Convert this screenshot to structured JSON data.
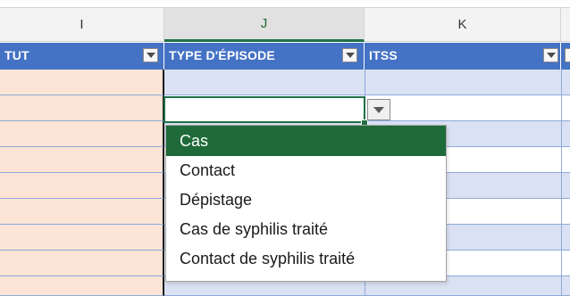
{
  "columns": [
    {
      "letter": "I",
      "selected": false
    },
    {
      "letter": "J",
      "selected": true
    },
    {
      "letter": "K",
      "selected": false
    }
  ],
  "headers": {
    "col_i": "TUT",
    "col_j": "TYPE D'ÉPISODE",
    "col_k": "ITSS"
  },
  "dropdown": {
    "selected_index": 0,
    "options": [
      "Cas",
      "Contact",
      "Dépistage",
      "Cas de syphilis traité",
      "Contact de syphilis traité"
    ]
  },
  "colors": {
    "header_blue": "#4472c4",
    "band_blue": "#d9e1f2",
    "peach": "#fce4d6",
    "selection_green": "#1e6a39",
    "active_border_green": "#1e7145"
  }
}
